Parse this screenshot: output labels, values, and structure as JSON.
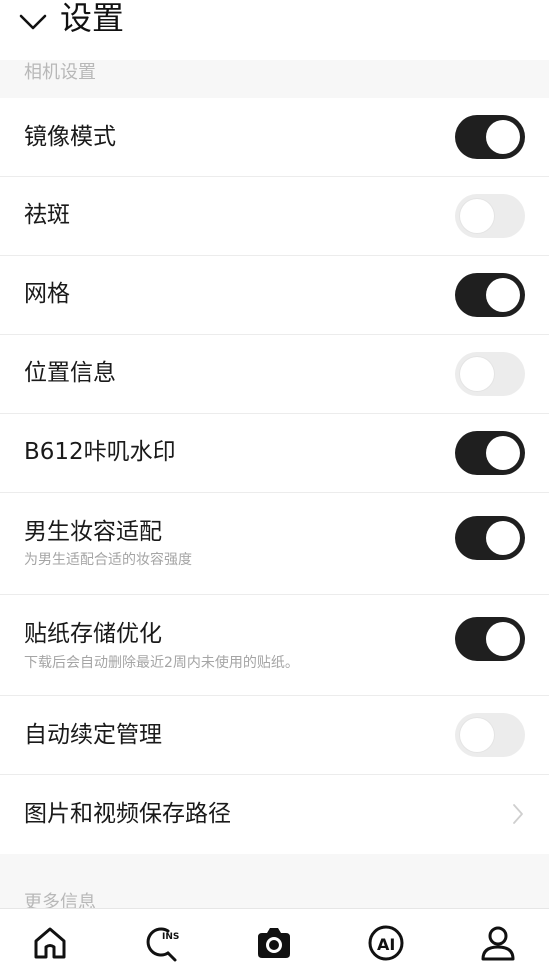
{
  "header": {
    "title": "设置",
    "back_icon": "chevron-down-icon"
  },
  "sections": {
    "camera": "相机设置",
    "more": "更多信息"
  },
  "settings": [
    {
      "label": "镜像模式",
      "state": "on"
    },
    {
      "label": "祛斑",
      "state": "off"
    },
    {
      "label": "网格",
      "state": "on"
    },
    {
      "label": "位置信息",
      "state": "off"
    },
    {
      "label": "B612咔叽水印",
      "state": "on"
    },
    {
      "label": "男生妆容适配",
      "sub": "为男生适配合适的妆容强度",
      "state": "on"
    },
    {
      "label": "贴纸存储优化",
      "sub": "下载后会自动删除最近2周内未使用的贴纸。",
      "state": "on"
    },
    {
      "label": "自动续定管理",
      "state": "off"
    },
    {
      "label": "图片和视频保存路径",
      "state": "arrow"
    }
  ],
  "tabbar": {
    "icons": [
      "home-icon",
      "ins-search-icon",
      "camera-icon",
      "ai-icon",
      "profile-icon"
    ],
    "ins_text": "INS",
    "ai_text": "AI"
  },
  "colors": {
    "toggle_on": "#1f1f1f",
    "toggle_off": "#ececec",
    "section_text": "#b8b8b8"
  }
}
